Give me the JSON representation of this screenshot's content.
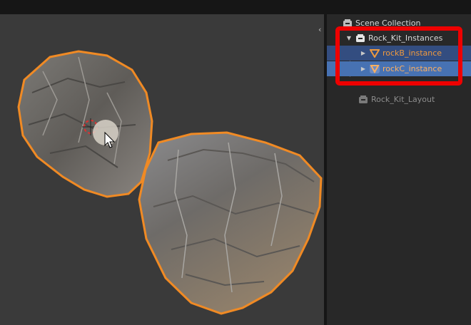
{
  "outliner": {
    "scene_collection": {
      "label": "Scene Collection",
      "icon": "scene-collection-icon"
    },
    "items": [
      {
        "label": "Rock_Kit_Instances",
        "type": "collection",
        "icon": "collection-icon",
        "expanded": true
      },
      {
        "label": "rockB_instance",
        "type": "object",
        "icon": "empty-instance-icon",
        "state": "selected"
      },
      {
        "label": "rockC_instance",
        "type": "object",
        "icon": "empty-instance-icon",
        "state": "active"
      },
      {
        "label": "Rock_Kit_Layout",
        "type": "collection",
        "icon": "collection-icon",
        "disabled": true
      }
    ]
  },
  "colors": {
    "selection_outline": "#f08a24",
    "active_row": "#4772b3",
    "selected_row": "#334d80",
    "annotation_box": "#ee0000"
  }
}
